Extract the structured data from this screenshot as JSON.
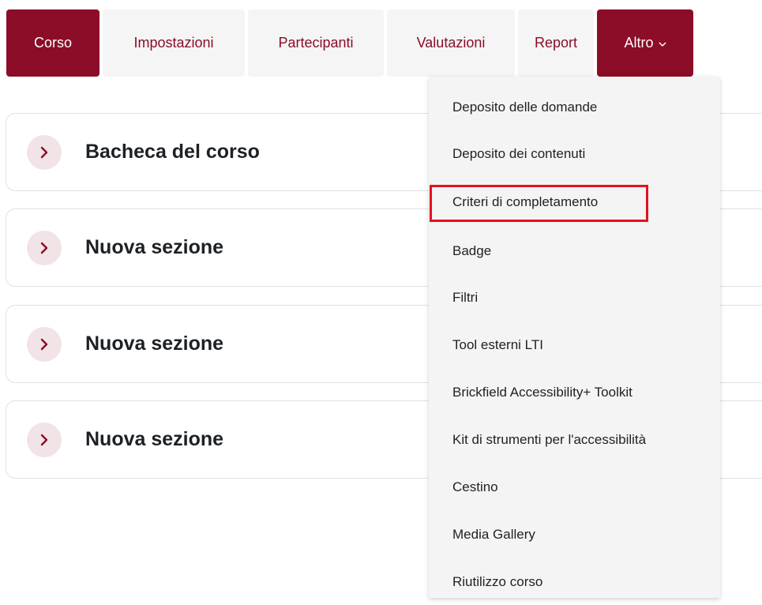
{
  "nav": {
    "tabs": [
      {
        "label": "Corso",
        "active": true
      },
      {
        "label": "Impostazioni",
        "active": false
      },
      {
        "label": "Partecipanti",
        "active": false
      },
      {
        "label": "Valutazioni",
        "active": false
      },
      {
        "label": "Report",
        "active": false
      },
      {
        "label": "Altro",
        "active": true,
        "icon": "chevron-down-icon"
      }
    ]
  },
  "sections": [
    {
      "title": "Bacheca del corso",
      "icon": "chevron-right-icon"
    },
    {
      "title": "Nuova sezione",
      "icon": "chevron-right-icon"
    },
    {
      "title": "Nuova sezione",
      "icon": "chevron-right-icon"
    },
    {
      "title": "Nuova sezione",
      "icon": "chevron-right-icon"
    }
  ],
  "dropdown": {
    "items": [
      {
        "label": "Deposito delle domande"
      },
      {
        "label": "Deposito dei contenuti"
      },
      {
        "label": "Criteri di completamento",
        "highlighted": true
      },
      {
        "label": "Badge"
      },
      {
        "label": "Filtri"
      },
      {
        "label": "Tool esterni LTI"
      },
      {
        "label": "Brickfield Accessibility+ Toolkit"
      },
      {
        "label": "Kit di strumenti per l'accessibilità"
      },
      {
        "label": "Cestino"
      },
      {
        "label": "Media Gallery"
      },
      {
        "label": "Riutilizzo corso"
      }
    ]
  },
  "colors": {
    "brand": "#8b0d28",
    "highlight": "#e3121d",
    "toggle_bg": "#f2e3e6"
  }
}
